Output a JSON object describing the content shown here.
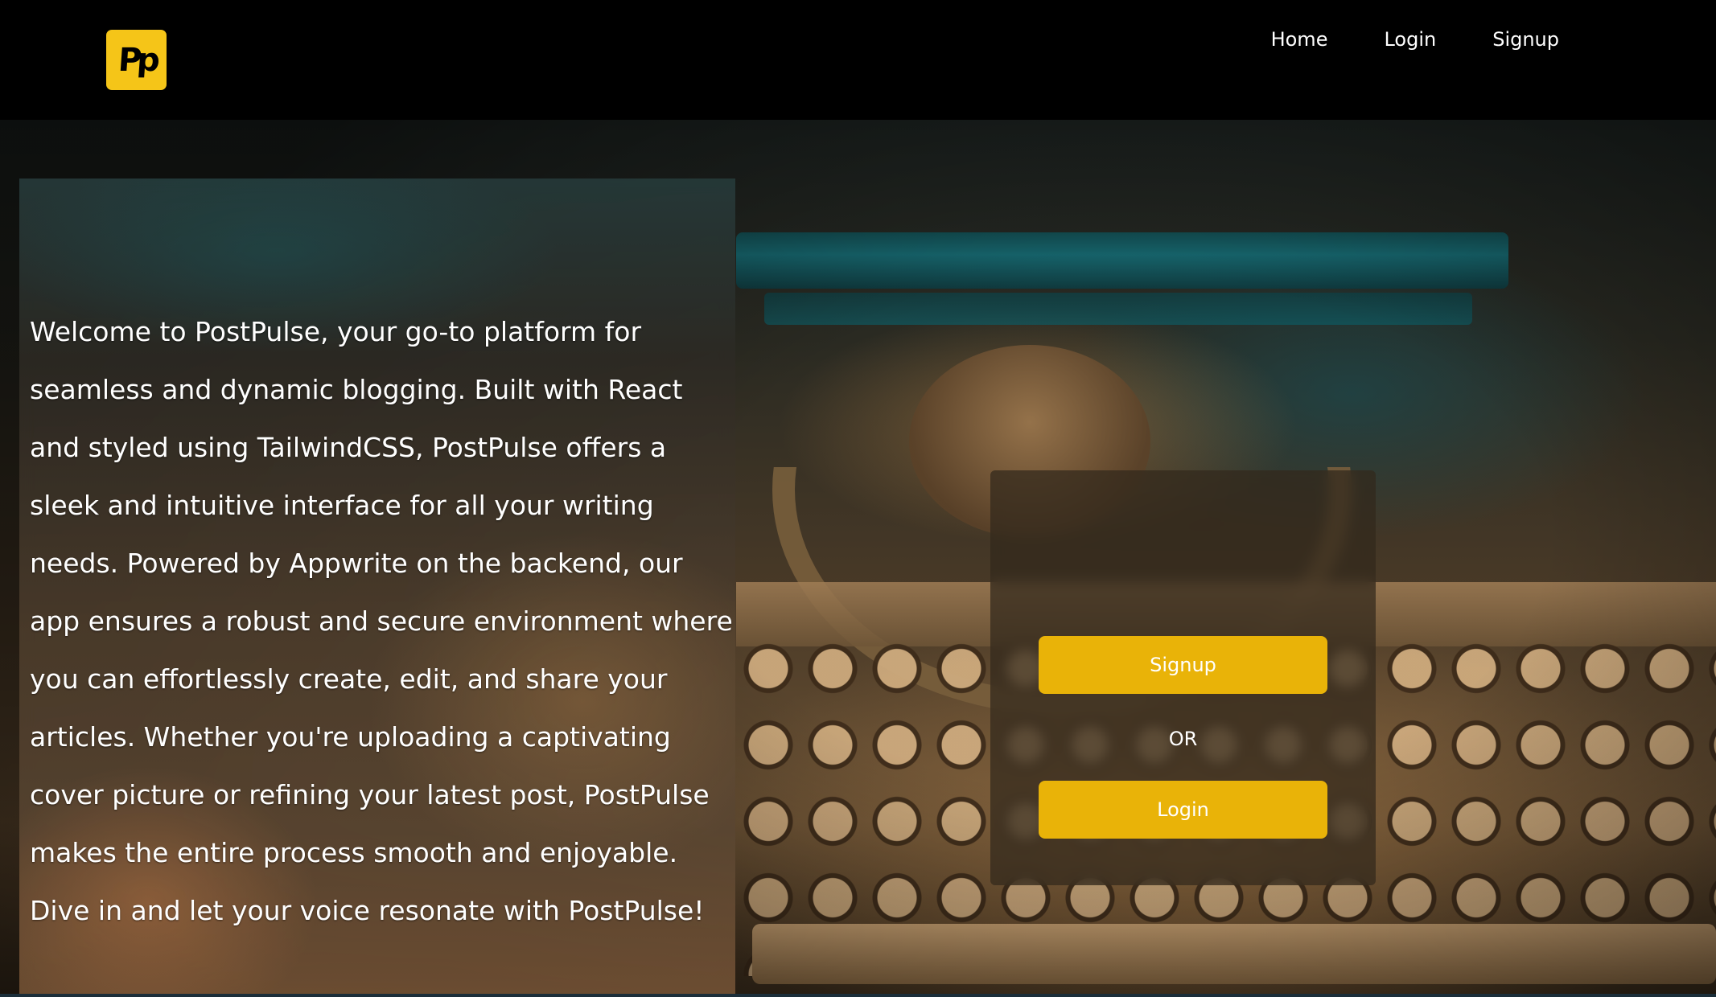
{
  "brand": {
    "logo_text": "Pp"
  },
  "nav": {
    "links": [
      {
        "label": "Home"
      },
      {
        "label": "Login"
      },
      {
        "label": "Signup"
      }
    ]
  },
  "hero": {
    "description": "Welcome to PostPulse, your go-to platform for seamless and dynamic blogging. Built with React and styled using TailwindCSS, PostPulse offers a sleek and intuitive interface for all your writing needs. Powered by Appwrite on the backend, our app ensures a robust and secure environment where you can effortlessly create, edit, and share your articles. Whether you're uploading a captivating cover picture or refining your latest post, PostPulse makes the entire process smooth and enjoyable. Dive in and let your voice resonate with PostPulse!"
  },
  "auth": {
    "signup_label": "Signup",
    "or_label": "OR",
    "login_label": "Login"
  },
  "colors": {
    "accent": "#e9b308",
    "logo_bg": "#f5c518",
    "navbar_bg": "#000000"
  }
}
